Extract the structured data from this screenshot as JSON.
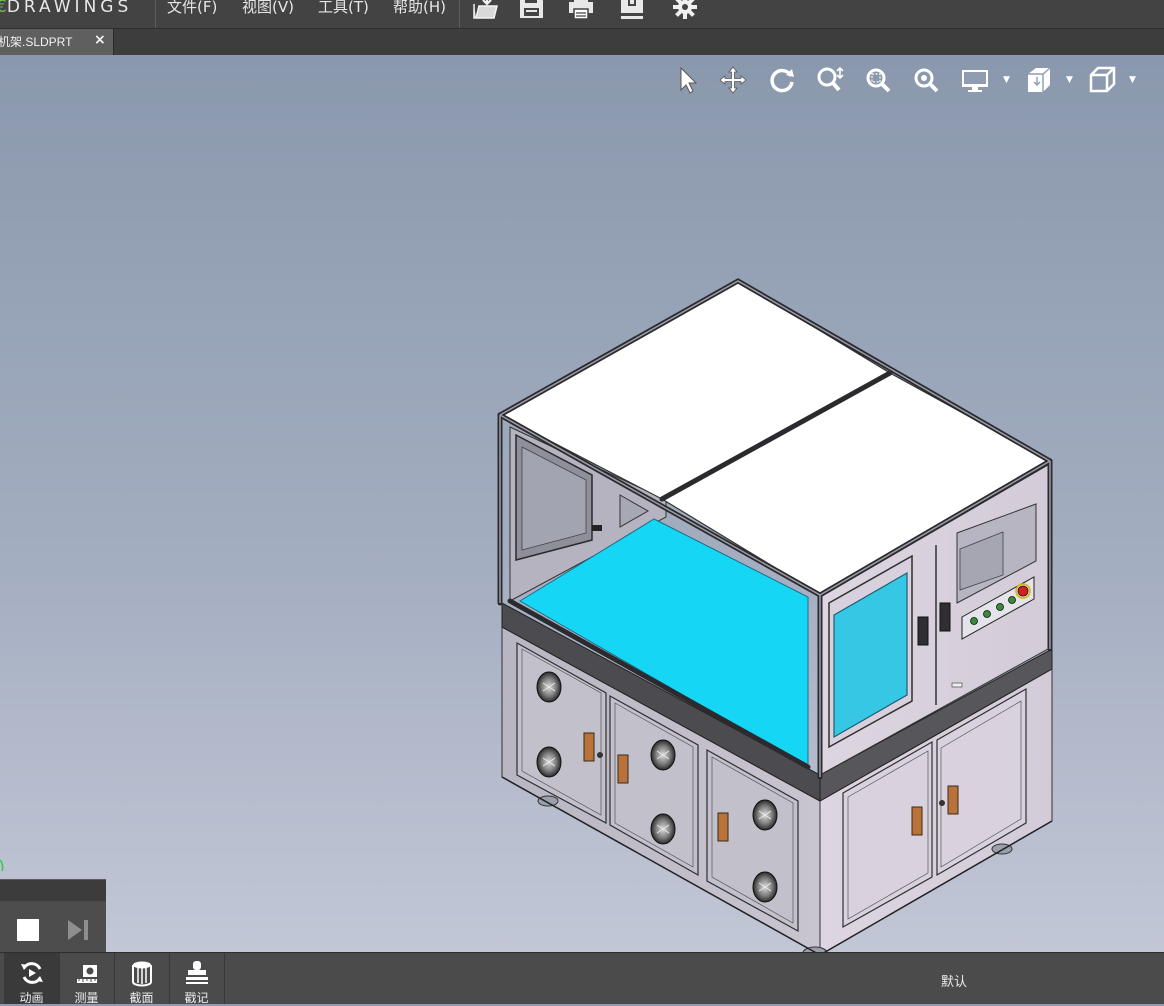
{
  "app": {
    "logo_text": "DRAWINGS"
  },
  "menu": {
    "items": [
      "文件(F)",
      "视图(V)",
      "工具(T)",
      "帮助(H)"
    ]
  },
  "toolbar": {
    "icons": [
      "open-file-icon",
      "save-icon",
      "print-icon",
      "document-properties-icon",
      "settings-gear-icon"
    ]
  },
  "tab": {
    "label": "机架.SLDPRT",
    "close": "×"
  },
  "view_toolbar": {
    "icons": [
      "select-arrow-icon",
      "pan-icon",
      "rotate-icon",
      "zoom-icon",
      "zoom-window-icon",
      "zoom-fit-icon",
      "display-style-icon",
      "view-orientation-icon",
      "standard-view-cube-icon"
    ]
  },
  "animation_panel": {
    "controls": [
      "stop-icon",
      "step-forward-icon"
    ]
  },
  "bottom_toolbar": {
    "buttons": [
      {
        "label": "动画",
        "icon": "animation-icon"
      },
      {
        "label": "测量",
        "icon": "measure-icon"
      },
      {
        "label": "截面",
        "icon": "section-icon"
      },
      {
        "label": "戳记",
        "icon": "stamp-icon"
      }
    ],
    "configuration": "默认"
  },
  "colors": {
    "menubar": "#434343",
    "viewport_top": "#8a98ad",
    "viewport_bottom": "#c2c7d6",
    "table_surface": "#15d6f5",
    "window_glass": "#35c7e3",
    "handle_orange": "#b8723a",
    "panel_frame": "#d8d0dc"
  }
}
